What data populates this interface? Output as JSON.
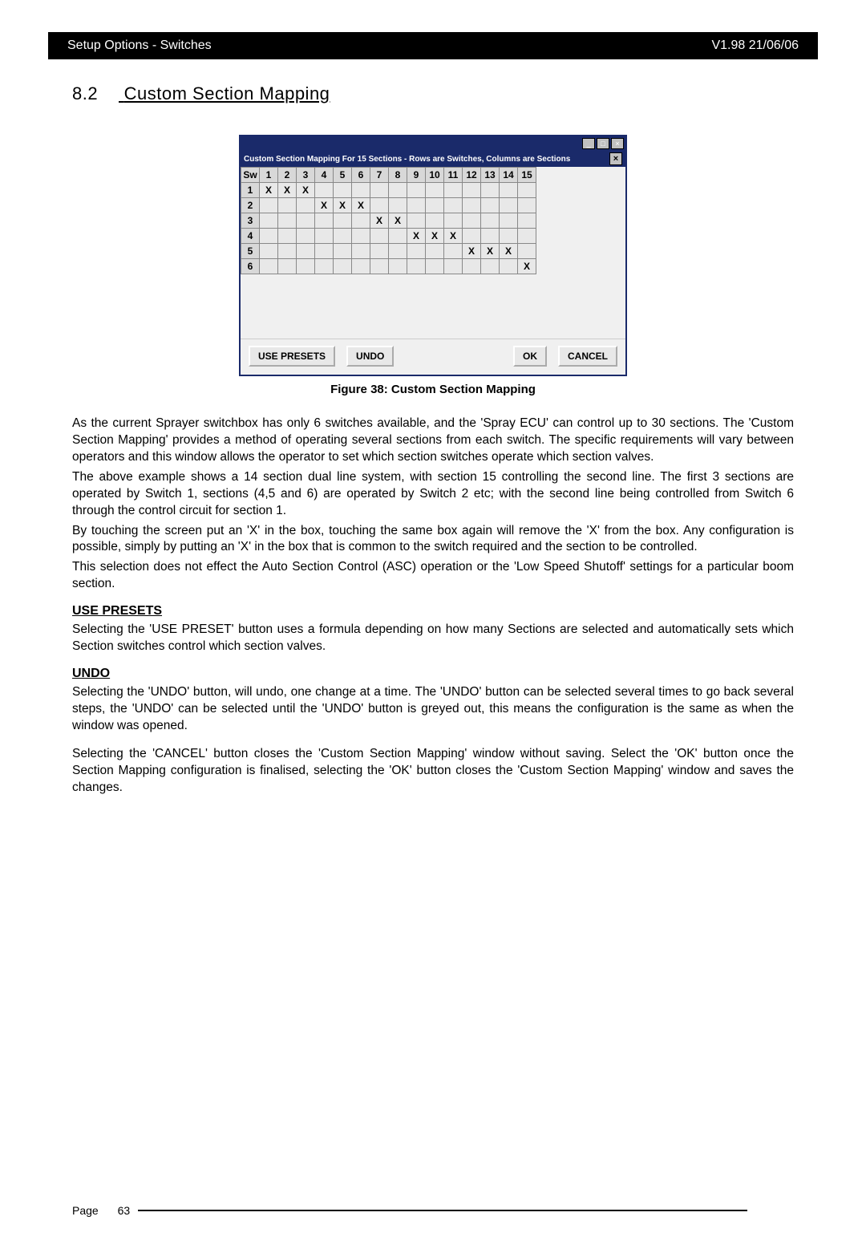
{
  "header": {
    "left": "Setup Options - Switches",
    "right": "V1.98 21/06/06"
  },
  "section": {
    "number": "8.2",
    "title": "Custom Section Mapping"
  },
  "dialog": {
    "app_title": "",
    "caption": "Custom Section Mapping For 15 Sections - Rows are Switches, Columns are Sections",
    "corner_label": "Sw",
    "columns": [
      "1",
      "2",
      "3",
      "4",
      "5",
      "6",
      "7",
      "8",
      "9",
      "10",
      "11",
      "12",
      "13",
      "14",
      "15"
    ],
    "rows": [
      "1",
      "2",
      "3",
      "4",
      "5",
      "6"
    ],
    "grid": [
      [
        "X",
        "X",
        "X",
        "",
        "",
        "",
        "",
        "",
        "",
        "",
        "",
        "",
        "",
        "",
        ""
      ],
      [
        "",
        "",
        "",
        "X",
        "X",
        "X",
        "",
        "",
        "",
        "",
        "",
        "",
        "",
        "",
        ""
      ],
      [
        "",
        "",
        "",
        "",
        "",
        "",
        "X",
        "X",
        "",
        "",
        "",
        "",
        "",
        "",
        ""
      ],
      [
        "",
        "",
        "",
        "",
        "",
        "",
        "",
        "",
        "X",
        "X",
        "X",
        "",
        "",
        "",
        ""
      ],
      [
        "",
        "",
        "",
        "",
        "",
        "",
        "",
        "",
        "",
        "",
        "",
        "X",
        "X",
        "X",
        ""
      ],
      [
        "",
        "",
        "",
        "",
        "",
        "",
        "",
        "",
        "",
        "",
        "",
        "",
        "",
        "",
        "X"
      ]
    ],
    "buttons": {
      "use_presets": "USE PRESETS",
      "undo": "UNDO",
      "ok": "OK",
      "cancel": "CANCEL"
    }
  },
  "figure_caption": "Figure 38:  Custom Section Mapping",
  "body": {
    "p1": "As the current Sprayer switchbox has only 6 switches available, and the 'Spray ECU' can control up to 30 sections. The 'Custom Section Mapping' provides a method of operating several sections from each switch. The specific requirements will vary between operators and this window allows the operator to set which section switches operate which section valves.",
    "p2": "The above example shows a 14 section dual line system, with section 15 controlling the second line. The first 3 sections are operated by Switch 1, sections (4,5 and 6) are operated by Switch 2 etc; with the second line being controlled from Switch 6 through the control circuit for section 1.",
    "p3": "By touching the screen put an 'X' in the box, touching the same box again will remove the 'X' from the box. Any configuration is possible, simply by putting an 'X' in the box that is common to the switch required and the section to be controlled.",
    "p4": "This selection does not effect the Auto Section Control (ASC) operation or the 'Low Speed Shutoff' settings for a particular boom section.",
    "use_presets_head": "USE PRESETS",
    "use_presets_body": "Selecting the 'USE PRESET' button uses a formula depending on how many Sections are selected and automatically sets which Section switches control which section valves.",
    "undo_head": "UNDO",
    "undo_body": "Selecting the 'UNDO' button, will undo, one change at a time. The 'UNDO' button can be selected several times to go back several steps, the 'UNDO' can be selected until the 'UNDO' button is greyed out, this means the configuration is the same as when the window was opened.",
    "cancel_body": "Selecting the 'CANCEL' button closes the 'Custom Section Mapping' window without saving. Select the 'OK' button once the Section Mapping configuration is finalised, selecting the 'OK' button closes the 'Custom Section Mapping' window and saves the changes."
  },
  "footer": {
    "page_label": "Page",
    "page_number": "63"
  }
}
